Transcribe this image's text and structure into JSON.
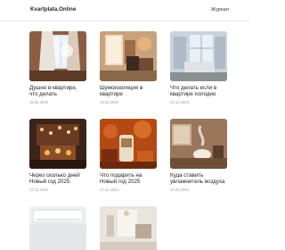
{
  "header": {
    "logo": "Kvartplata.Online",
    "nav_label": "Журнал"
  },
  "posts": [
    {
      "title": "Душно в квартире, что делать",
      "date": "16.02.2025",
      "image": "window-curtains-photo"
    },
    {
      "title": "Шумоизоляция в квартире",
      "date": "24.01.2025",
      "image": "living-room-photo"
    },
    {
      "title": "Что делать если в квартире холодно",
      "date": "23.12.2024",
      "image": "cold-room-photo"
    },
    {
      "title": "Через сколько дней Новый год 2025",
      "date": "27.11.2024",
      "image": "new-year-room-photo"
    },
    {
      "title": "Что подарить на Новый год 2025",
      "date": "17.12.2024",
      "image": "gift-candle-photo"
    },
    {
      "title": "Куда ставить увлажнитель воздуха",
      "date": "10.01.2024",
      "image": "humidifier-photo"
    },
    {
      "title": "",
      "date": "",
      "image": "air-conditioner-photo"
    },
    {
      "title": "",
      "date": "",
      "image": "bright-room-photo"
    }
  ],
  "colors": {
    "title_text": "#1e1e1e",
    "date_text": "#8aa0b4"
  }
}
